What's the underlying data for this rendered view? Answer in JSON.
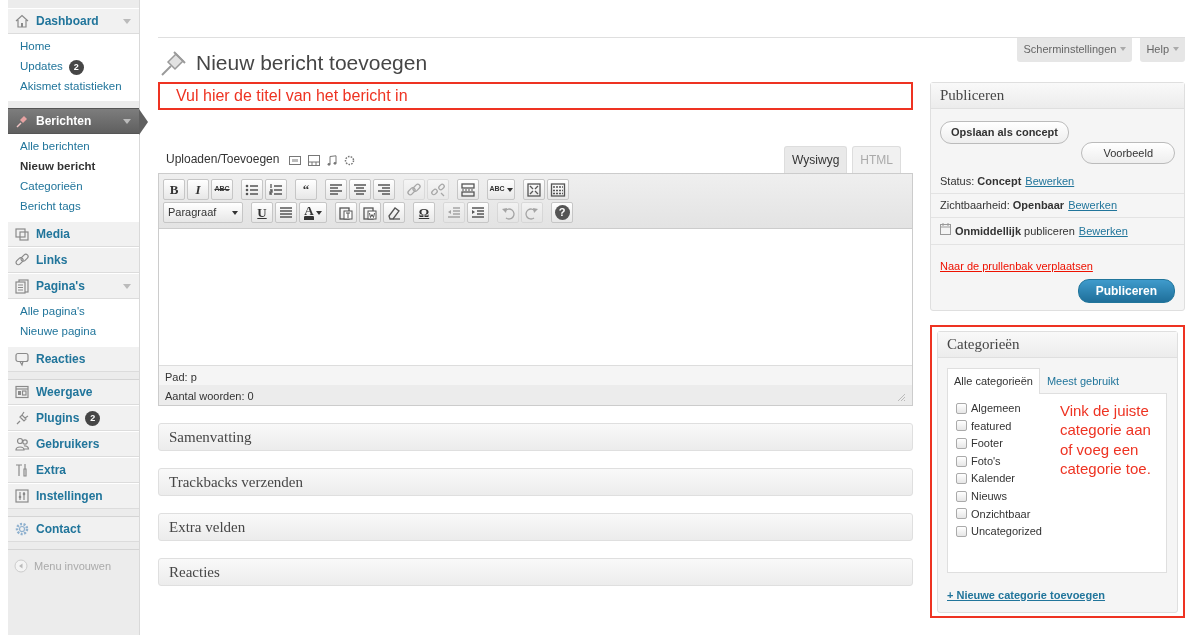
{
  "sidebar": {
    "menus": [
      {
        "label": "Dashboard",
        "selected": false,
        "separator_before": false,
        "has_submenu": true,
        "children": [
          {
            "label": "Home",
            "selected": false
          },
          {
            "label": "Updates",
            "selected": false,
            "badge": "2"
          },
          {
            "label": "Akismet statistieken",
            "selected": false
          }
        ]
      },
      {
        "label": "Berichten",
        "selected": true,
        "separator_before": true,
        "has_submenu": true,
        "children": [
          {
            "label": "Alle berichten",
            "selected": false
          },
          {
            "label": "Nieuw bericht",
            "selected": true
          },
          {
            "label": "Categorieën",
            "selected": false
          },
          {
            "label": "Bericht tags",
            "selected": false
          }
        ]
      },
      {
        "label": "Media",
        "selected": false,
        "separator_before": false,
        "has_submenu": false
      },
      {
        "label": "Links",
        "selected": false,
        "separator_before": false,
        "has_submenu": false
      },
      {
        "label": "Pagina's",
        "selected": false,
        "separator_before": false,
        "has_submenu": true,
        "children": [
          {
            "label": "Alle pagina's",
            "selected": false
          },
          {
            "label": "Nieuwe pagina",
            "selected": false
          }
        ]
      },
      {
        "label": "Reacties",
        "selected": false,
        "separator_before": false,
        "has_submenu": false
      },
      {
        "label": "Weergave",
        "selected": false,
        "separator_before": true,
        "has_submenu": false
      },
      {
        "label": "Plugins",
        "selected": false,
        "separator_before": false,
        "has_submenu": false,
        "badge": "2"
      },
      {
        "label": "Gebruikers",
        "selected": false,
        "separator_before": false,
        "has_submenu": false
      },
      {
        "label": "Extra",
        "selected": false,
        "separator_before": false,
        "has_submenu": false
      },
      {
        "label": "Instellingen",
        "selected": false,
        "separator_before": false,
        "has_submenu": false
      },
      {
        "label": "Contact",
        "selected": false,
        "separator_before": true,
        "has_submenu": false
      }
    ],
    "collapse": {
      "label": "Menu invouwen"
    }
  },
  "screen_meta": {
    "buttons": [
      {
        "label": "Scherminstellingen"
      },
      {
        "label": "Help"
      }
    ]
  },
  "heading": "Nieuw bericht toevoegen",
  "title_field": {
    "hint": "Vul hier de titel van het bericht in",
    "highlighted": true
  },
  "media": {
    "label": "Uploaden/Toevoegen"
  },
  "editor_tabs": [
    {
      "label": "Wysiwyg",
      "selected": true
    },
    {
      "label": "HTML",
      "selected": false
    }
  ],
  "toolbar": {
    "rows": [
      {
        "buttons": [
          {
            "kind": "text",
            "label": "B",
            "disabled": false
          },
          {
            "kind": "text",
            "label": "I",
            "disabled": false
          },
          {
            "kind": "text",
            "label": "ABC",
            "disabled": false
          },
          {
            "kind": "icon",
            "disabled": false
          },
          {
            "kind": "icon",
            "disabled": false
          },
          {
            "kind": "text",
            "label": "“",
            "disabled": false
          },
          {
            "kind": "icon",
            "disabled": false
          },
          {
            "kind": "icon",
            "disabled": false
          },
          {
            "kind": "icon",
            "disabled": false
          },
          {
            "kind": "icon",
            "disabled": true
          },
          {
            "kind": "icon",
            "disabled": true
          },
          {
            "kind": "icon",
            "disabled": false
          },
          {
            "kind": "split",
            "label": "ABC",
            "disabled": false
          },
          {
            "kind": "icon",
            "disabled": false
          },
          {
            "kind": "icon",
            "disabled": false
          }
        ]
      },
      {
        "buttons": [
          {
            "kind": "select",
            "label": "Paragraaf",
            "disabled": false
          },
          {
            "kind": "text",
            "label": "U",
            "disabled": false
          },
          {
            "kind": "icon",
            "disabled": false
          },
          {
            "kind": "split",
            "label": "A",
            "disabled": false
          },
          {
            "kind": "icon",
            "disabled": false
          },
          {
            "kind": "icon",
            "disabled": false
          },
          {
            "kind": "icon",
            "disabled": false
          },
          {
            "kind": "text",
            "label": "Ω",
            "disabled": false
          },
          {
            "kind": "icon",
            "disabled": true
          },
          {
            "kind": "icon",
            "disabled": false
          },
          {
            "kind": "icon",
            "disabled": true
          },
          {
            "kind": "icon",
            "disabled": true
          },
          {
            "kind": "help",
            "label": "?",
            "disabled": false
          }
        ]
      }
    ]
  },
  "editor_status": {
    "path": "Pad: p",
    "word_count": "Aantal woorden: 0"
  },
  "boxes": [
    {
      "title": "Samenvatting"
    },
    {
      "title": "Trackbacks verzenden"
    },
    {
      "title": "Extra velden"
    },
    {
      "title": "Reacties"
    }
  ],
  "publish": {
    "title": "Publiceren",
    "save_button": "Opslaan als concept",
    "preview_button": "Voorbeeld",
    "rows": [
      {
        "kind": "status",
        "text": "Status: **Concept**",
        "link": "Bewerken"
      },
      {
        "kind": "status",
        "text": "Zichtbaarheid: **Openbaar**",
        "link": "Bewerken"
      },
      {
        "kind": "schedule",
        "text": "**Onmiddellijk** publiceren",
        "link": "Bewerken"
      }
    ],
    "trash_link": "Naar de prullenbak verplaatsen",
    "publish_button": "Publiceren"
  },
  "categories": {
    "title": "Categorieën",
    "highlighted": true,
    "tabs": [
      {
        "label": "Alle categorieën",
        "selected": true
      },
      {
        "label": "Meest gebruikt",
        "selected": false
      }
    ],
    "items": [
      {
        "label": "Algemeen",
        "checked": false
      },
      {
        "label": "featured",
        "checked": false
      },
      {
        "label": "Footer",
        "checked": false
      },
      {
        "label": "Foto's",
        "checked": false
      },
      {
        "label": "Kalender",
        "checked": false
      },
      {
        "label": "Nieuws",
        "checked": false
      },
      {
        "label": "Onzichtbaar",
        "checked": false
      },
      {
        "label": "Uncategorized",
        "checked": false
      }
    ],
    "note": "Vink de juiste categorie aan of voeg een categorie toe.",
    "add_link": "+ Nieuwe categorie toevoegen"
  }
}
